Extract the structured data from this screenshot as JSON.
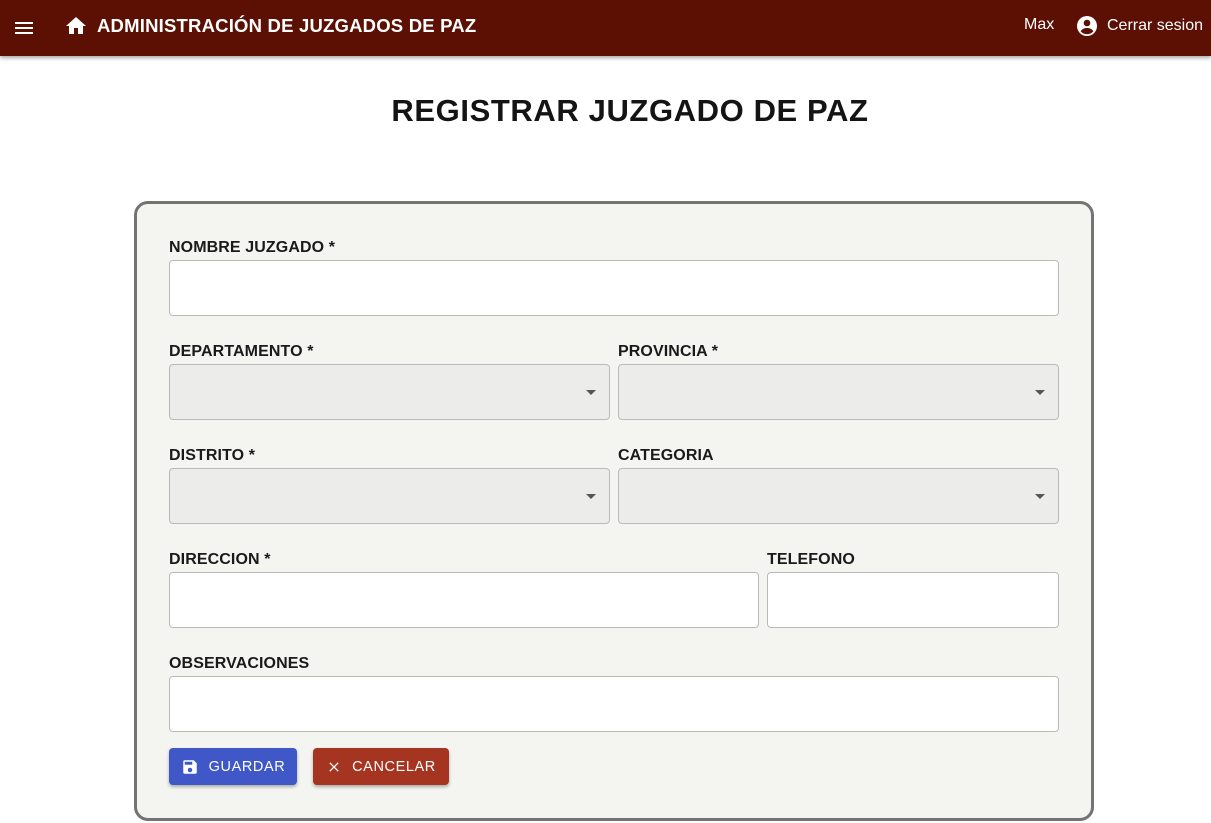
{
  "appbar": {
    "title": "ADMINISTRACIÓN DE JUZGADOS DE PAZ",
    "user_name": "Max",
    "logout_label": "Cerrar sesion",
    "menu_icon": "menu-icon",
    "home_icon": "home-icon",
    "account_icon": "account-circle-icon",
    "background_color": "#5c1004"
  },
  "page": {
    "title": "REGISTRAR JUZGADO DE PAZ"
  },
  "form": {
    "fields": {
      "nombre": {
        "label": "NOMBRE JUZGADO *",
        "value": ""
      },
      "departamento": {
        "label": "DEPARTAMENTO *",
        "value": ""
      },
      "provincia": {
        "label": "PROVINCIA *",
        "value": ""
      },
      "distrito": {
        "label": "DISTRITO *",
        "value": ""
      },
      "categoria": {
        "label": "CATEGORIA",
        "value": ""
      },
      "direccion": {
        "label": "DIRECCION *",
        "value": ""
      },
      "telefono": {
        "label": "TELEFONO",
        "value": ""
      },
      "observaciones": {
        "label": "OBSERVACIONES",
        "value": ""
      }
    },
    "buttons": {
      "save": {
        "label": "GUARDAR",
        "icon": "save-icon",
        "color": "#4057c8"
      },
      "cancel": {
        "label": "CANCELAR",
        "icon": "close-icon",
        "color": "#a53421"
      }
    }
  }
}
